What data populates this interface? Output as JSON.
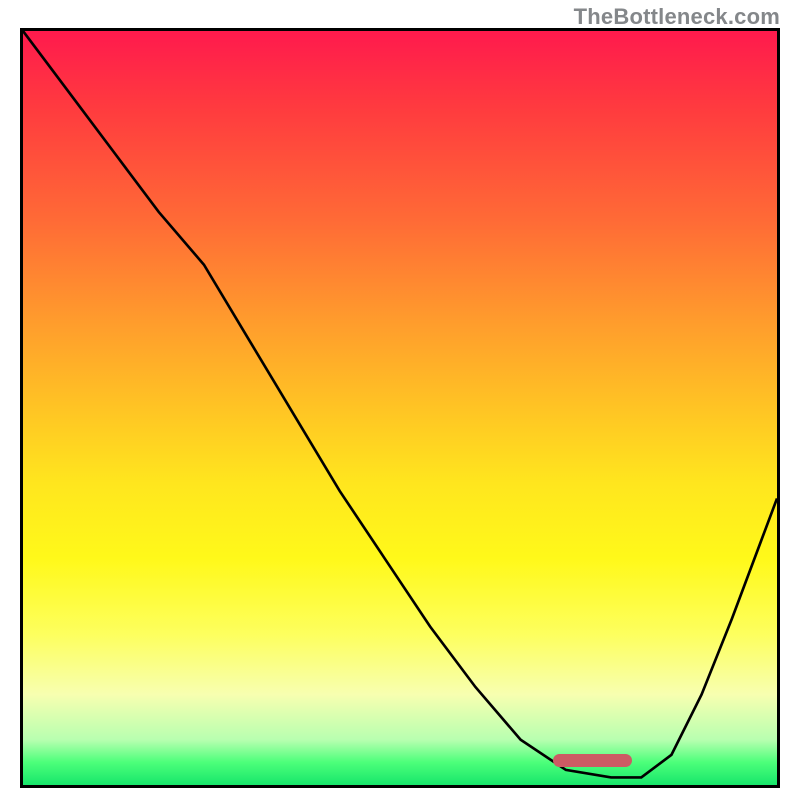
{
  "watermark": "TheBottleneck.com",
  "colors": {
    "gradient_top": "#ff1a4d",
    "gradient_mid": "#ffe61e",
    "gradient_bottom": "#17e66b",
    "curve": "#000000",
    "marker": "#cc5b64",
    "frame": "#000000"
  },
  "marker": {
    "x_norm": 0.755,
    "y_norm": 0.968,
    "w_norm": 0.105,
    "h_norm": 0.017
  },
  "chart_data": {
    "type": "line",
    "title": "",
    "xlabel": "",
    "ylabel": "",
    "xlim": [
      0,
      100
    ],
    "ylim": [
      0,
      100
    ],
    "series": [
      {
        "name": "curve",
        "x": [
          0,
          6,
          12,
          18,
          24,
          30,
          36,
          42,
          48,
          54,
          60,
          66,
          72,
          78,
          82,
          86,
          90,
          94,
          100
        ],
        "y": [
          100,
          92,
          84,
          76,
          69,
          59,
          49,
          39,
          30,
          21,
          13,
          6,
          2,
          1,
          1,
          4,
          12,
          22,
          38
        ]
      }
    ],
    "optimal_band_x": [
      72,
      82
    ]
  }
}
